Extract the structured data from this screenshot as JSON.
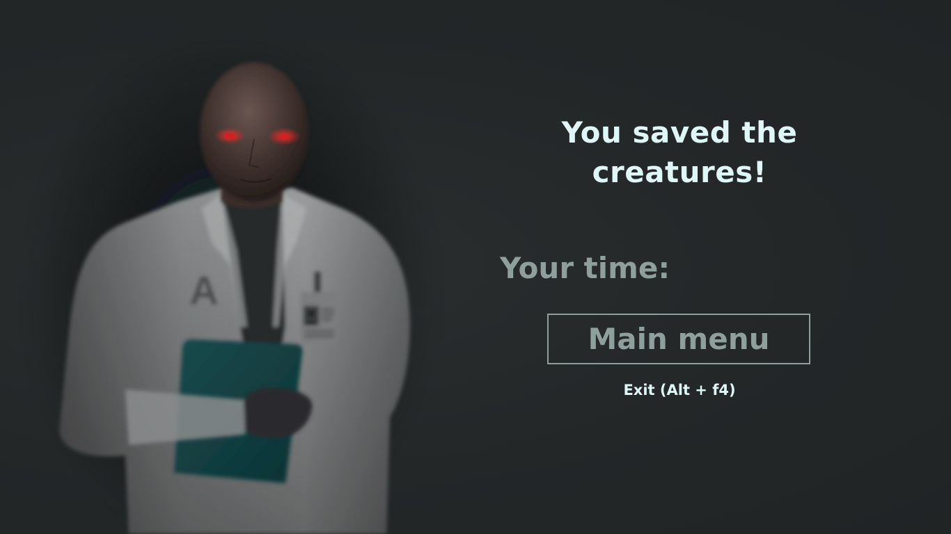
{
  "end_screen": {
    "title_line1": "You saved the",
    "title_line2": "creatures!",
    "time_label": "Your time:",
    "main_menu_label": "Main menu",
    "exit_label": "Exit (Alt + f4)"
  },
  "character": {
    "description_icon": "scientist-figure",
    "coat_letter": "A"
  },
  "colors": {
    "background": "#232728",
    "title": "#dff7f6",
    "secondary": "#8e9f9c",
    "eyes": "#d42020",
    "clipboard": "#124446"
  }
}
